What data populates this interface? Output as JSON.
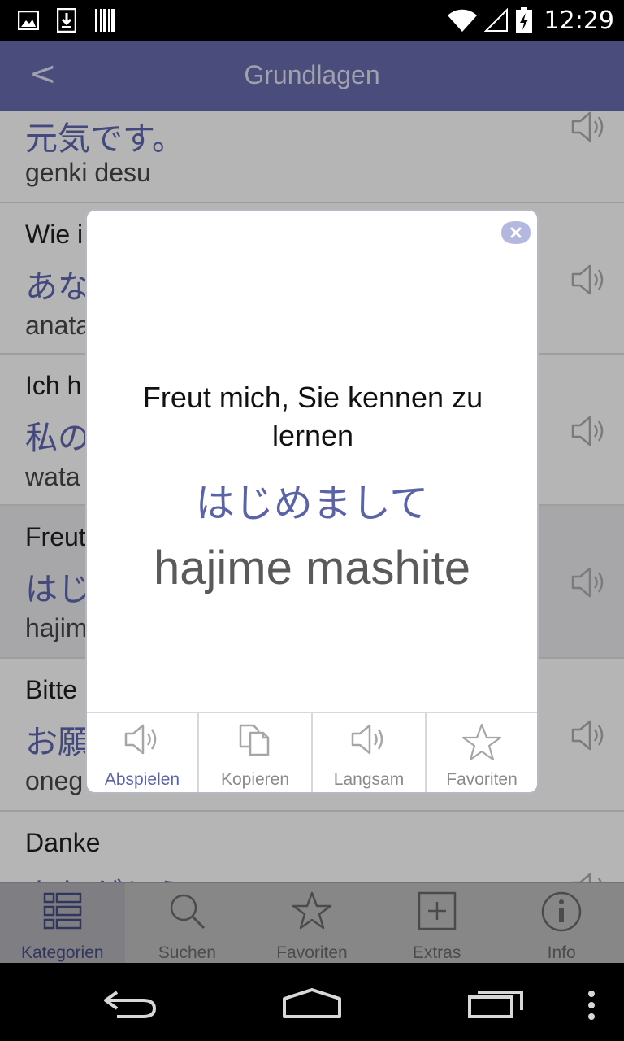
{
  "status_bar": {
    "time": "12:29",
    "icons": [
      "image-icon",
      "download-icon",
      "barcode-icon",
      "wifi-icon",
      "signal-icon",
      "battery-icon"
    ]
  },
  "header": {
    "back_label": "<",
    "title": "Grundlagen"
  },
  "list": {
    "rows": [
      {
        "de": "",
        "jp": "元気です。",
        "ro": "genki desu"
      },
      {
        "de": "Wie i",
        "jp": "あな",
        "ro": "anata"
      },
      {
        "de": "Ich h",
        "jp": "私の",
        "ro": "wata"
      },
      {
        "de": "Freut",
        "jp": "はじ",
        "ro": "hajim"
      },
      {
        "de": "Bitte",
        "jp": "お願",
        "ro": "oneg"
      },
      {
        "de": "Danke",
        "jp": "ありがとう",
        "ro": ""
      }
    ]
  },
  "dialog": {
    "german": "Freut mich, Sie kennen zu lernen",
    "japanese": "はじめまして",
    "romaji": "hajime mashite",
    "actions": [
      {
        "label": "Abspielen",
        "icon": "speaker-icon"
      },
      {
        "label": "Kopieren",
        "icon": "copy-icon"
      },
      {
        "label": "Langsam",
        "icon": "speaker-icon"
      },
      {
        "label": "Favoriten",
        "icon": "star-icon"
      }
    ]
  },
  "tabs": [
    {
      "label": "Kategorien",
      "icon": "list-icon"
    },
    {
      "label": "Suchen",
      "icon": "search-icon"
    },
    {
      "label": "Favoriten",
      "icon": "star-icon"
    },
    {
      "label": "Extras",
      "icon": "plus-box-icon"
    },
    {
      "label": "Info",
      "icon": "info-icon"
    }
  ],
  "colors": {
    "accent": "#5b63a8",
    "header_bg": "#6569a6",
    "header_text": "#d8d9ea",
    "inactive": "#8a8a8a"
  }
}
